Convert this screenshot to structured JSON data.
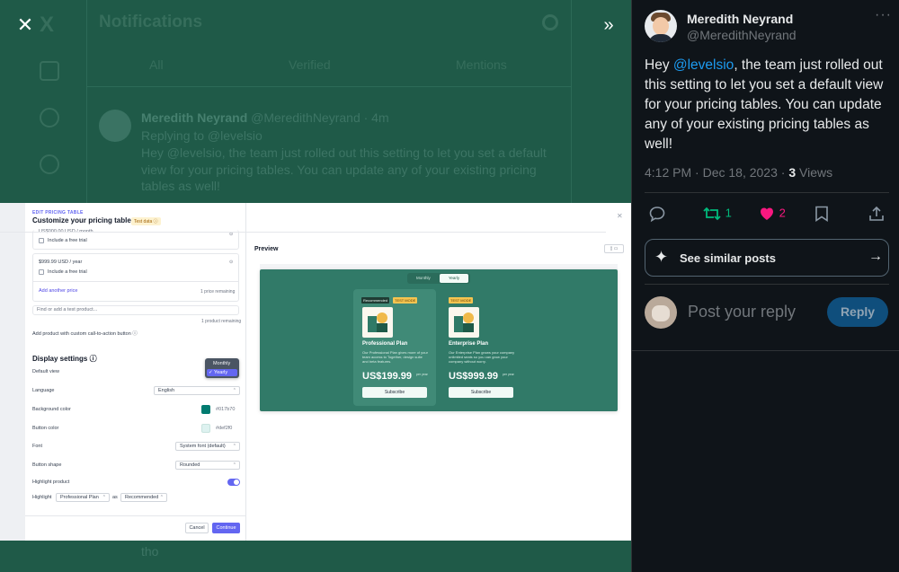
{
  "background": {
    "page_title": "Notifications",
    "tabs": [
      "All",
      "Verified",
      "Mentions"
    ],
    "notification": {
      "author": "Meredith Neyrand",
      "handle": "@MeredithNeyrand · 4m",
      "replying": "Replying to @levelsio",
      "line1": "Hey @levelsio, the team just rolled out this setting to let you set a default",
      "line2": "view for your pricing tables. You can update any of your existing pricing",
      "line3": "tables as well!"
    },
    "bottom_text": "tho"
  },
  "viewer": {
    "close_label": "✕",
    "expand_label": "»"
  },
  "screenshot": {
    "eyebrow": "EDIT PRICING TABLE",
    "title": "Customize your pricing table",
    "test_badge": "Test data ⓘ",
    "price1": "US$000.00 USD / month",
    "free_trial": "Include a free trial",
    "price2": "$999.99 USD / year",
    "add_price": "Add another price",
    "price_remaining": "1 price remaining",
    "product_placeholder": "Find or add a test product...",
    "product_remaining": "1 product remaining",
    "add_product_cta": "Add product with custom call-to-action button ⓘ",
    "display_settings": "Display settings ⓘ",
    "default_view_label": "Default view",
    "default_view_options": [
      "Monthly",
      "✓ Yearly"
    ],
    "language_label": "Language",
    "language_value": "English",
    "bg_color_label": "Background color",
    "bg_color_value": "#017b70",
    "button_color_label": "Button color",
    "button_color_value": "#def2f0",
    "font_label": "Font",
    "font_value": "System font (default)",
    "button_shape_label": "Button shape",
    "button_shape_value": "Rounded",
    "highlight_product_label": "Highlight product",
    "highlight_label": "Highlight",
    "highlight_value": "Professional Plan",
    "as_label": "as",
    "as_value": "Recommended",
    "cancel": "Cancel",
    "continue": "Continue",
    "preview_label": "Preview",
    "close": "✕",
    "preview": {
      "toggle_monthly": "Monthly",
      "toggle_yearly": "Yearly",
      "plans": [
        {
          "badge1": "Recommended",
          "badge2": "TEST MODE",
          "name": "Professional Plan",
          "desc": "Our Professional Plan gives more of your team access to Together, design suite and beta features.",
          "price": "US$199.99",
          "per": "per year",
          "cta": "Subscribe"
        },
        {
          "badge2": "TEST MODE",
          "name": "Enterprise Plan",
          "desc": "Our Enterprise Plan grows your company unlimited seats so you can grow your company without worry.",
          "price": "US$999.99",
          "per": "per year",
          "cta": "Subscribe"
        }
      ]
    }
  },
  "tweet": {
    "display_name": "Meredith Neyrand",
    "handle": "@MeredithNeyrand",
    "more": "···",
    "text_before": "Hey ",
    "mention": "@levelsio",
    "text_after": ", the team just rolled out this setting to let you set a default view for your pricing tables. You can update any of your existing pricing tables as well!",
    "time": "4:12 PM · Dec 18, 2023 · ",
    "views_count": "3",
    "views_label": " Views",
    "retweets": "1",
    "likes": "2",
    "see_similar": "See similar posts",
    "reply_placeholder": "Post your reply",
    "reply_button": "Reply"
  },
  "colors": {
    "mention": "#1d9bf0",
    "retweet": "#00ba7c",
    "like": "#f91880",
    "overlay_green": "#1f5a48",
    "preview_green": "#317a68"
  }
}
